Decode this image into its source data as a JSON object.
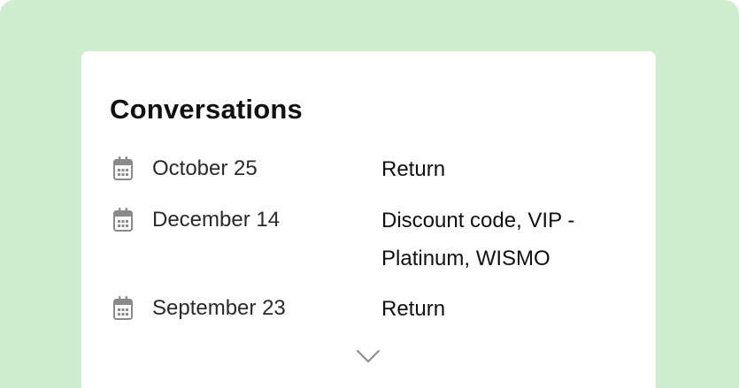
{
  "card": {
    "title": "Conversations"
  },
  "conversations": [
    {
      "date": "October 25",
      "tags": "Return",
      "icon": "calendar-icon"
    },
    {
      "date": "December 14",
      "tags": "Discount code, VIP - Platinum, WISMO",
      "icon": "calendar-icon"
    },
    {
      "date": "September 23",
      "tags": "Return",
      "icon": "calendar-icon"
    }
  ],
  "expand": {
    "icon": "chevron-down-icon"
  },
  "colors": {
    "background": "#cfeecf",
    "card": "#ffffff",
    "icon": "#8a8a8a",
    "text": "#111111"
  }
}
